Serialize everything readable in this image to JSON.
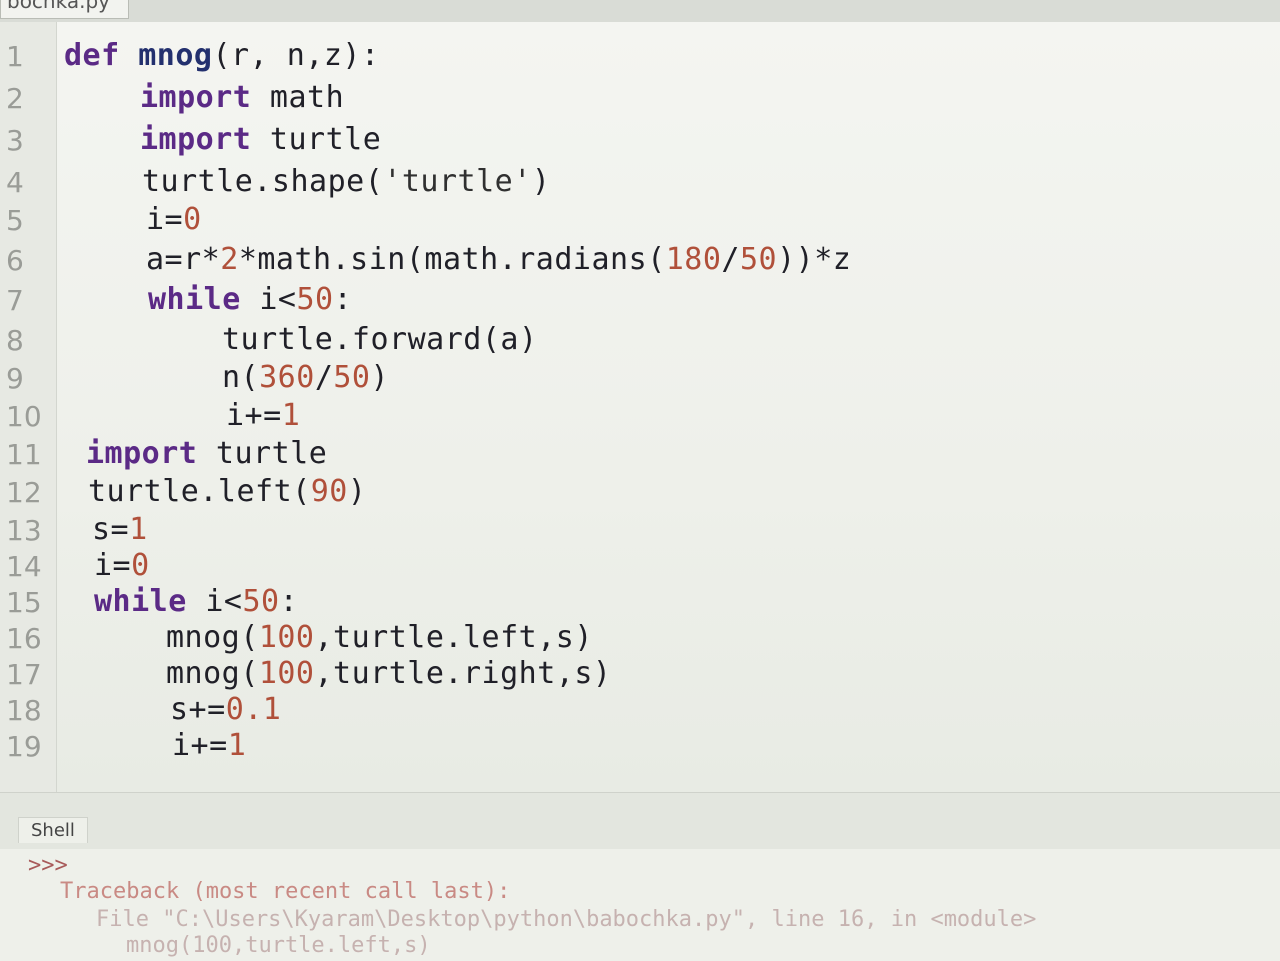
{
  "tab": {
    "filename": "bochka.py"
  },
  "editor": {
    "line_numbers": [
      "1",
      "2",
      "3",
      "4",
      "5",
      "6",
      "7",
      "8",
      "9",
      "10",
      "11",
      "12",
      "13",
      "14",
      "15",
      "16",
      "17",
      "18",
      "19"
    ],
    "lines": [
      [
        {
          "t": "def",
          "c": "kw"
        },
        {
          "t": " "
        },
        {
          "t": "mnog",
          "c": "fn"
        },
        {
          "t": "(r, n,z):"
        }
      ],
      [
        {
          "t": "import",
          "c": "kw"
        },
        {
          "t": " math"
        }
      ],
      [
        {
          "t": "import",
          "c": "kw"
        },
        {
          "t": " turtle"
        }
      ],
      [
        {
          "t": "turtle.shape("
        },
        {
          "t": "'turtle'",
          "c": "str"
        },
        {
          "t": ")"
        }
      ],
      [
        {
          "t": "i="
        },
        {
          "t": "0",
          "c": "num"
        }
      ],
      [
        {
          "t": "a=r*"
        },
        {
          "t": "2",
          "c": "num"
        },
        {
          "t": "*math.sin(math.radians("
        },
        {
          "t": "180",
          "c": "num"
        },
        {
          "t": "/"
        },
        {
          "t": "50",
          "c": "num"
        },
        {
          "t": "))*z"
        }
      ],
      [
        {
          "t": "while",
          "c": "kw"
        },
        {
          "t": " i<"
        },
        {
          "t": "50",
          "c": "num"
        },
        {
          "t": ":"
        }
      ],
      [
        {
          "t": "turtle.forward(a)"
        }
      ],
      [
        {
          "t": "n("
        },
        {
          "t": "360",
          "c": "num"
        },
        {
          "t": "/"
        },
        {
          "t": "50",
          "c": "num"
        },
        {
          "t": ")"
        }
      ],
      [
        {
          "t": "i+="
        },
        {
          "t": "1",
          "c": "num"
        }
      ],
      [
        {
          "t": "import",
          "c": "kw"
        },
        {
          "t": " turtle"
        }
      ],
      [
        {
          "t": "turtle.left("
        },
        {
          "t": "90",
          "c": "num"
        },
        {
          "t": ")"
        }
      ],
      [
        {
          "t": "s="
        },
        {
          "t": "1",
          "c": "num"
        }
      ],
      [
        {
          "t": "i="
        },
        {
          "t": "0",
          "c": "num"
        }
      ],
      [
        {
          "t": "while",
          "c": "kw"
        },
        {
          "t": " i<"
        },
        {
          "t": "50",
          "c": "num"
        },
        {
          "t": ":"
        }
      ],
      [
        {
          "t": "mnog("
        },
        {
          "t": "100",
          "c": "num"
        },
        {
          "t": ",turtle.left,s)"
        }
      ],
      [
        {
          "t": "mnog("
        },
        {
          "t": "100",
          "c": "num"
        },
        {
          "t": ",turtle.right,s)"
        }
      ],
      [
        {
          "t": "s+="
        },
        {
          "t": "0.1",
          "c": "num"
        }
      ],
      [
        {
          "t": "i+="
        },
        {
          "t": "1",
          "c": "num"
        }
      ]
    ]
  },
  "shell": {
    "tab_label": "Shell",
    "prompt": ">>>",
    "traceback_header": "Traceback (most recent call last):",
    "file_line": "File \"C:\\Users\\Kyaram\\Desktop\\python\\babochka.py\", line 16, in <module>",
    "call_line": "mnog(100,turtle.left,s)"
  },
  "colors": {
    "keyword": "#5b2a86",
    "number": "#b0503a",
    "error": "#c98a84"
  }
}
